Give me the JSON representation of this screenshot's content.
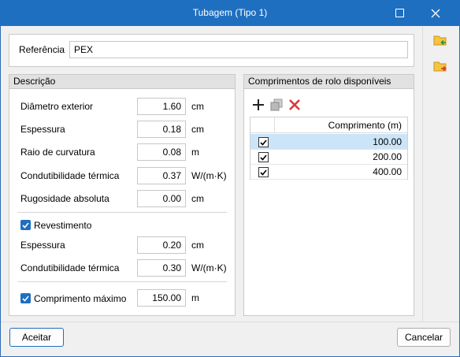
{
  "window": {
    "title": "Tubagem (Tipo 1)"
  },
  "reference": {
    "label": "Referência",
    "value": "PEX"
  },
  "description": {
    "header": "Descrição",
    "fields": [
      {
        "label": "Diâmetro exterior",
        "value": "1.60",
        "unit": "cm"
      },
      {
        "label": "Espessura",
        "value": "0.18",
        "unit": "cm"
      },
      {
        "label": "Raio de curvatura",
        "value": "0.08",
        "unit": "m"
      },
      {
        "label": "Condutibilidade térmica",
        "value": "0.37",
        "unit": "W/(m·K)"
      },
      {
        "label": "Rugosidade absoluta",
        "value": "0.00",
        "unit": "cm"
      }
    ],
    "coating": {
      "label": "Revestimento",
      "checked": true,
      "fields": [
        {
          "label": "Espessura",
          "value": "0.20",
          "unit": "cm"
        },
        {
          "label": "Condutibilidade térmica",
          "value": "0.30",
          "unit": "W/(m·K)"
        }
      ]
    },
    "max_length": {
      "label": "Comprimento máximo",
      "checked": true,
      "value": "150.00",
      "unit": "m"
    }
  },
  "rolls": {
    "header": "Comprimentos de rolo disponíveis",
    "toolbar": [
      "add-icon",
      "duplicate-icon",
      "delete-icon"
    ],
    "column": "Comprimento (m)",
    "rows": [
      {
        "checked": true,
        "value": "100.00",
        "selected": true
      },
      {
        "checked": true,
        "value": "200.00",
        "selected": false
      },
      {
        "checked": true,
        "value": "400.00",
        "selected": false
      }
    ]
  },
  "sidebar": {
    "icons": [
      "folder-import-icon",
      "folder-export-icon"
    ]
  },
  "footer": {
    "accept": "Aceitar",
    "cancel": "Cancelar"
  },
  "colors": {
    "accent": "#1f6fc0",
    "selected_row": "#cce4f7",
    "delete": "#d9393b"
  }
}
